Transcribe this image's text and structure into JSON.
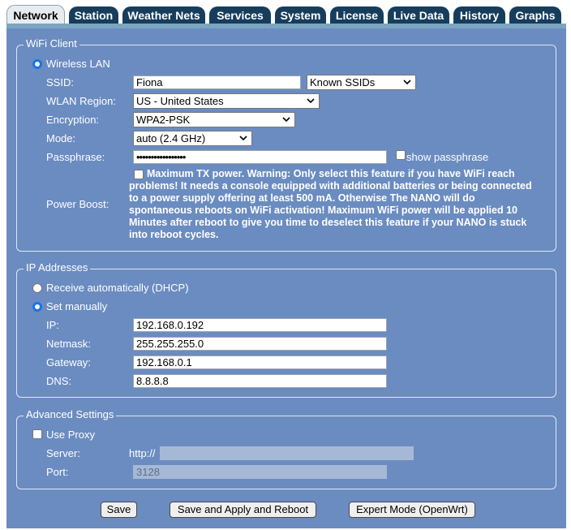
{
  "tabs": [
    {
      "label": "Network",
      "active": true
    },
    {
      "label": "Station"
    },
    {
      "label": "Weather Nets"
    },
    {
      "label": "Services"
    },
    {
      "label": "System"
    },
    {
      "label": "License"
    },
    {
      "label": "Live Data"
    },
    {
      "label": "History"
    },
    {
      "label": "Graphs"
    }
  ],
  "wifi": {
    "legend": "WiFi Client",
    "wireless_lan_label": "Wireless LAN",
    "ssid_label": "SSID:",
    "ssid_value": "Fiona",
    "known_ssids": "Known SSIDs",
    "region_label": "WLAN Region:",
    "region_value": "US - United States",
    "encryption_label": "Encryption:",
    "encryption_value": "WPA2-PSK",
    "mode_label": "Mode:",
    "mode_value": "auto (2.4 GHz)",
    "passphrase_label": "Passphrase:",
    "passphrase_value": "•••••••••••••••••",
    "show_passphrase": "show passphrase",
    "power_boost_label": "Power Boost:",
    "power_boost_text": "Maximum TX power. Warning: Only select this feature if you have WiFi reach problems! It needs a console equipped with additional batteries or being connected to a power supply offering at least 500 mA. Otherwise The NANO will do spontaneous reboots on WiFi activation! Maximum WiFi power will be applied 10 Minutes after reboot to give you time to deselect this feature if your NANO is stuck into reboot cycles."
  },
  "ip": {
    "legend": "IP Addresses",
    "dhcp_label": "Receive automatically (DHCP)",
    "manual_label": "Set manually",
    "ip_label": "IP:",
    "ip_value": "192.168.0.192",
    "netmask_label": "Netmask:",
    "netmask_value": "255.255.255.0",
    "gateway_label": "Gateway:",
    "gateway_value": "192.168.0.1",
    "dns_label": "DNS:",
    "dns_value": "8.8.8.8"
  },
  "advanced": {
    "legend": "Advanced Settings",
    "use_proxy_label": "Use Proxy",
    "server_label": "Server:",
    "server_prefix": "http://",
    "server_value": "",
    "port_label": "Port:",
    "port_placeholder": "3128"
  },
  "buttons": {
    "save": "Save",
    "save_apply_reboot": "Save and Apply and Reboot",
    "expert_mode": "Expert Mode (OpenWrt)"
  },
  "colors": {
    "panel": "#6b8cc1",
    "tab": "#173d5c",
    "tab_active": "#e9ecef",
    "radio_accent": "#1a73e8"
  }
}
